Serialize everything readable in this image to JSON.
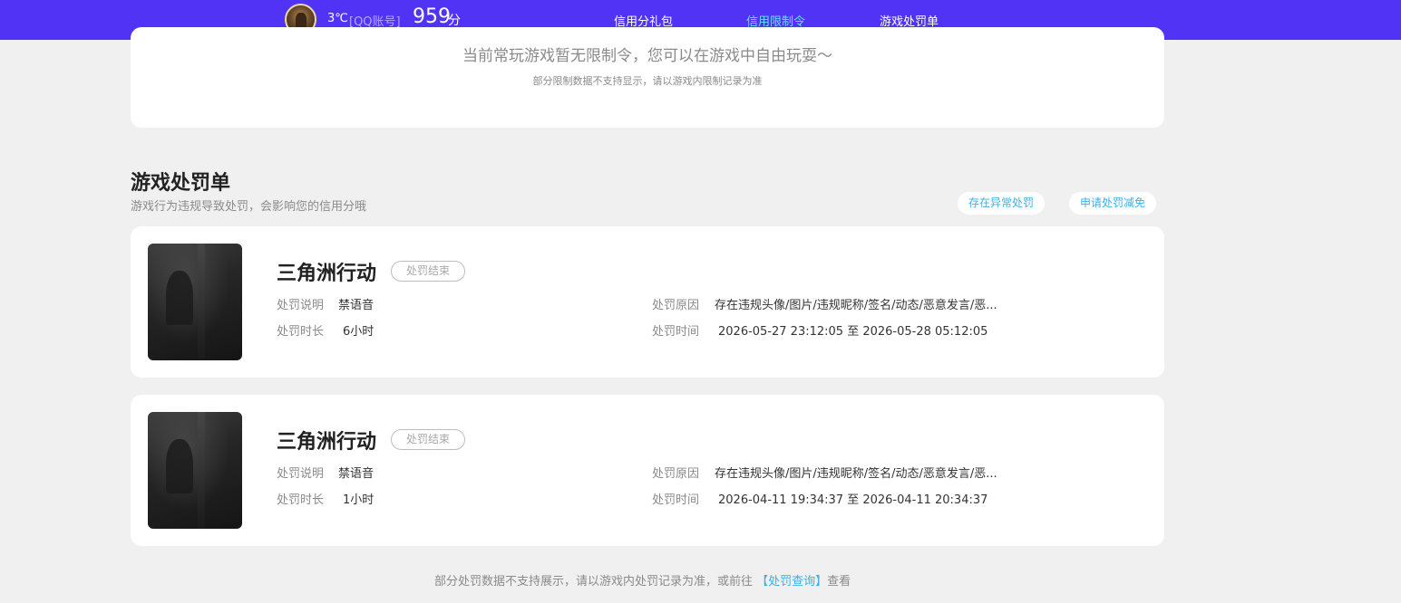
{
  "header": {
    "nickname": "3℃",
    "account_type": "[QQ账号]",
    "score": "959",
    "score_unit": "分",
    "nav": [
      "信用分礼包",
      "信用限制令",
      "游戏处罚单"
    ],
    "active_nav": "信用限制令",
    "bar_color": "#5033f5",
    "active_color": "#5fe3ff"
  },
  "limit_card": {
    "message": "当前常玩游戏暂无限制令，您可以在游戏中自由玩耍～",
    "note": "部分限制数据不支持显示，请以游戏内限制记录为准"
  },
  "penalty_section": {
    "title": "游戏处罚单",
    "subtitle": "游戏行为违规导致处罚，会影响您的信用分哦",
    "buttons": [
      "存在异常处罚",
      "申请处罚减免"
    ],
    "records": [
      {
        "game": "三角洲行动",
        "status": "处罚结束",
        "desc_label": "处罚说明",
        "desc": "禁语音",
        "duration_label": "处罚时长",
        "duration": "6小时",
        "reason_label": "处罚原因",
        "reason": "存在违规头像/图片/违规昵称/签名/动态/恶意发言/恶...",
        "time_label": "处罚时间",
        "time": "2026-05-27 23:12:05 至 2026-05-28 05:12:05"
      },
      {
        "game": "三角洲行动",
        "status": "处罚结束",
        "desc_label": "处罚说明",
        "desc": "禁语音",
        "duration_label": "处罚时长",
        "duration": "1小时",
        "reason_label": "处罚原因",
        "reason": "存在违规头像/图片/违规昵称/签名/动态/恶意发言/恶...",
        "time_label": "处罚时间",
        "time": "2026-04-11 19:34:37 至 2026-04-11 20:34:37"
      }
    ]
  },
  "footer": {
    "prefix": "部分处罚数据不支持展示，请以游戏内处罚记录为准，或前往",
    "link": "【处罚查询】",
    "suffix": "查看"
  }
}
